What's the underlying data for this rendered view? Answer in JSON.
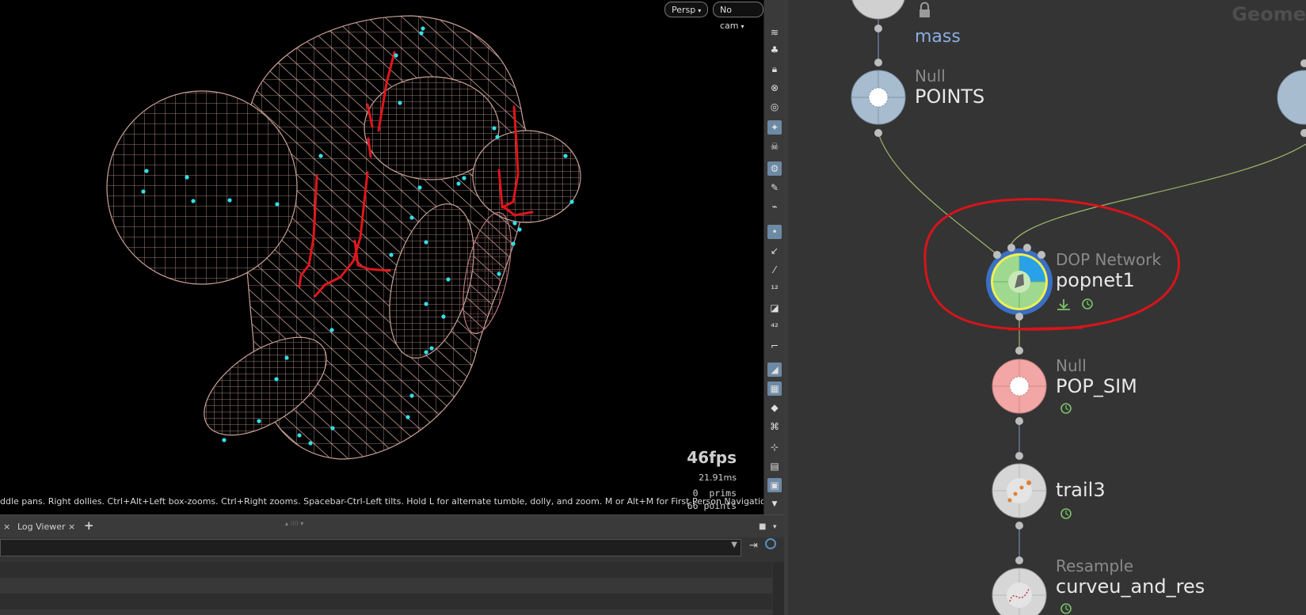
{
  "viewport": {
    "persp_label": "Persp",
    "cam_label": "No cam",
    "fps": "46fps",
    "frame_time": "21.91ms",
    "prims_count": "0",
    "prims_label": "prims",
    "points_count": "66",
    "points_label": "points",
    "hint": "ddle pans. Right dollies. Ctrl+Alt+Left box-zooms. Ctrl+Right zooms. Spacebar-Ctrl-Left tilts. Hold L for alternate tumble, dolly, and zoom. M or Alt+M for First Person Navigation."
  },
  "toolbar_icons": [
    "layers-icon",
    "grass-icon",
    "lock-icon",
    "ghost-icon",
    "visibility-icon",
    "light-icon",
    "skull-icon",
    "render-icon",
    "flash-icon",
    "flashlight-icon",
    "point-display-icon",
    "normal-icon",
    "pick-icon",
    "point-number-icon",
    "shade-icon",
    "prim-number-icon",
    "axis-icon",
    "wire-icon",
    "texture-icon",
    "layer-icon",
    "uv-icon",
    "measure-icon",
    "disk-icon",
    "snapshot-icon"
  ],
  "bottom_panel": {
    "tab_close": "×",
    "log_tab": "Log Viewer",
    "add_tab": "+"
  },
  "network": {
    "corner_text": "Geome",
    "top_node_label": "mass",
    "nodes": [
      {
        "type": "Null",
        "name": "POINTS"
      },
      {
        "type": "DOP Network",
        "name": "popnet1"
      },
      {
        "type": "Null",
        "name": "POP_SIM"
      },
      {
        "type": "",
        "name": "trail3"
      },
      {
        "type": "Resample",
        "name": "curveu_and_res"
      }
    ],
    "colors": {
      "null_blue": "#a8bcd0",
      "null_red": "#f2a6a6",
      "dop_green": "#9fd98f",
      "dop_blue": "#2aa0e8",
      "annotation_red": "#d8141a",
      "wire_green": "#9fb86a"
    }
  }
}
